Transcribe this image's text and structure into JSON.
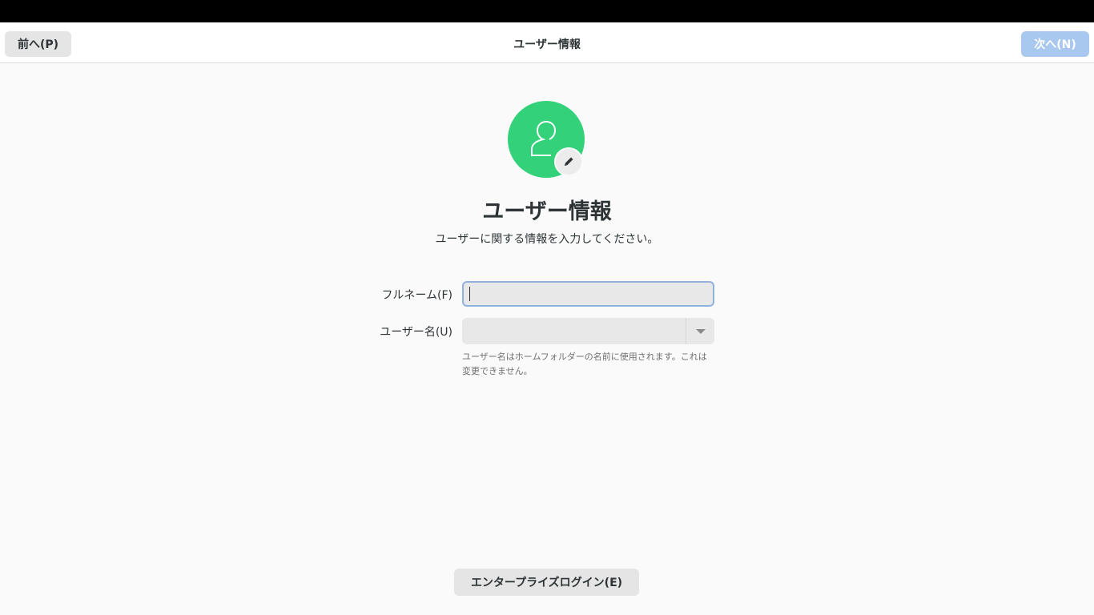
{
  "header": {
    "title": "ユーザー情報",
    "prev_label": "前へ(P)",
    "next_label": "次へ(N)"
  },
  "main": {
    "avatar_icon": "user-avatar-icon",
    "edit_icon": "pencil-icon",
    "title": "ユーザー情報",
    "subtitle": "ユーザーに関する情報を入力してください。",
    "fullname_label": "フルネーム(F)",
    "fullname_value": "",
    "username_label": "ユーザー名(U)",
    "username_value": "",
    "username_hint": "ユーザー名はホームフォルダーの名前に使用されます。これは変更できません。"
  },
  "footer": {
    "enterprise_label": "エンタープライズログイン(E)"
  },
  "colors": {
    "avatar_bg": "#33d17a",
    "next_button_bg": "#a8c8ef",
    "focus_border": "#8fb2e0"
  }
}
